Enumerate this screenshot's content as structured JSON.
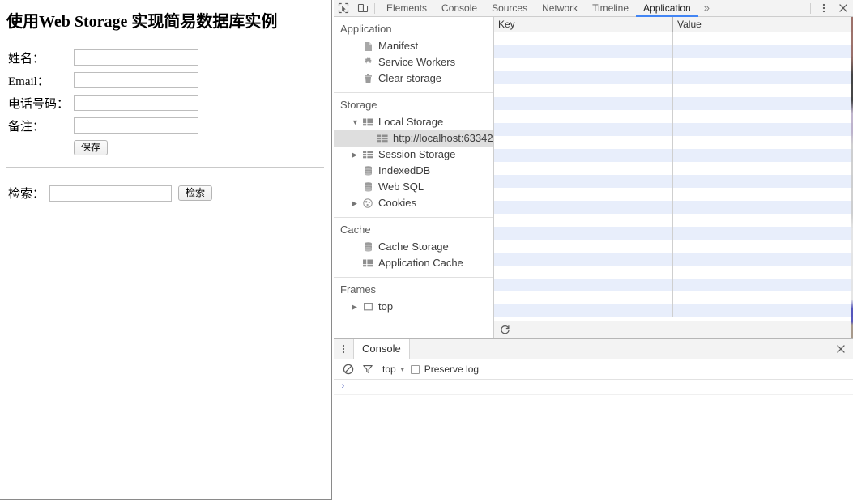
{
  "page": {
    "title": "使用Web Storage 实现简易数据库实例",
    "form_rows": [
      {
        "label": "姓名：",
        "value": "",
        "placeholder": "",
        "name": "name"
      },
      {
        "label": "Email：",
        "value": "",
        "placeholder": "",
        "name": "email"
      },
      {
        "label": "电话号码：",
        "value": "",
        "placeholder": "",
        "name": "phone"
      },
      {
        "label": "备注：",
        "value": "",
        "placeholder": "",
        "name": "memo"
      }
    ],
    "save_button": "保存",
    "search_label": "检索：",
    "search_value": "",
    "search_button": "检索"
  },
  "devtools": {
    "toolbar": {
      "inspect_icon": "inspect-element-icon",
      "device_icon": "device-toolbar-icon",
      "tabs": [
        {
          "label": "Elements",
          "active": false
        },
        {
          "label": "Console",
          "active": false
        },
        {
          "label": "Sources",
          "active": false
        },
        {
          "label": "Network",
          "active": false
        },
        {
          "label": "Timeline",
          "active": false
        },
        {
          "label": "Application",
          "active": true
        }
      ],
      "overflow_label": "»",
      "menu_icon": "vertical-dots-icon",
      "close_icon": "close-icon",
      "active_tab_underline_color": "#4285f4"
    },
    "sidebar": {
      "sections": [
        {
          "heading": "Application",
          "items": [
            {
              "label": "Manifest",
              "icon": "manifest-icon",
              "indent": 1,
              "arrow": "none",
              "selected": false
            },
            {
              "label": "Service Workers",
              "icon": "gear-icon",
              "indent": 1,
              "arrow": "none",
              "selected": false
            },
            {
              "label": "Clear storage",
              "icon": "trash-icon",
              "indent": 1,
              "arrow": "none",
              "selected": false
            }
          ]
        },
        {
          "heading": "Storage",
          "items": [
            {
              "label": "Local Storage",
              "icon": "table-icon",
              "indent": 1,
              "arrow": "expanded",
              "selected": false
            },
            {
              "label": "http://localhost:63342",
              "icon": "table-icon",
              "indent": 2,
              "arrow": "none",
              "selected": true
            },
            {
              "label": "Session Storage",
              "icon": "table-icon",
              "indent": 1,
              "arrow": "collapsed",
              "selected": false
            },
            {
              "label": "IndexedDB",
              "icon": "database-icon",
              "indent": 1,
              "arrow": "none",
              "selected": false
            },
            {
              "label": "Web SQL",
              "icon": "database-icon",
              "indent": 1,
              "arrow": "none",
              "selected": false
            },
            {
              "label": "Cookies",
              "icon": "cookie-icon",
              "indent": 1,
              "arrow": "collapsed",
              "selected": false
            }
          ]
        },
        {
          "heading": "Cache",
          "items": [
            {
              "label": "Cache Storage",
              "icon": "database-icon",
              "indent": 1,
              "arrow": "none",
              "selected": false
            },
            {
              "label": "Application Cache",
              "icon": "table-icon",
              "indent": 1,
              "arrow": "none",
              "selected": false
            }
          ]
        },
        {
          "heading": "Frames",
          "items": [
            {
              "label": "top",
              "icon": "frame-icon",
              "indent": 1,
              "arrow": "collapsed",
              "selected": false
            }
          ]
        }
      ]
    },
    "storage_table": {
      "columns": [
        "Key",
        "Value"
      ],
      "rows": [],
      "row_count_rendered": 22,
      "stripe_color": "#e8eefb",
      "refresh_icon": "refresh-icon"
    },
    "drawer": {
      "menu_icon": "vertical-dots-icon",
      "tab_label": "Console",
      "close_icon": "close-icon",
      "filter": {
        "clear_icon": "clear-console-icon",
        "filter_icon": "filter-funnel-icon",
        "context_label": "top",
        "context_caret": "▾",
        "preserve_log_label": "Preserve log",
        "preserve_log_checked": false
      },
      "prompt_glyph": "›",
      "prompt_value": ""
    }
  }
}
